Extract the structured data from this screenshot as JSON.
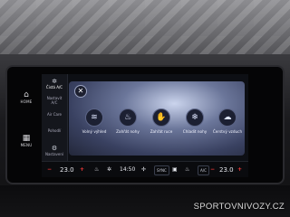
{
  "hard_keys": [
    {
      "icon": "home-icon",
      "label": "HOME"
    },
    {
      "icon": "menu-grid-icon",
      "label": "MENU"
    }
  ],
  "sidebar": [
    {
      "label": "Čistá A/C"
    },
    {
      "label": "Nastavit A/C"
    },
    {
      "label": "Air Care"
    },
    {
      "label": "Pohodlí"
    },
    {
      "label": "Nastavení"
    }
  ],
  "options": [
    {
      "icon": "defrost-icon",
      "label": "Volný výhled"
    },
    {
      "icon": "seat-heat-icon",
      "label": "Zahřát nohy"
    },
    {
      "icon": "hand-heat-icon",
      "label": "Zahřát ruce"
    },
    {
      "icon": "seat-cool-icon",
      "label": "Chladit nohy"
    },
    {
      "icon": "air-fresh-icon",
      "label": "Čerstvý vzduch"
    }
  ],
  "bottom_bar": {
    "left_temp": "23.0",
    "right_temp": "23.0",
    "minus": "−",
    "plus": "+",
    "clock": "14:50",
    "sync": "SYNC",
    "ac": "A/C"
  },
  "watermark": "SPORTOVNIVOZY.CZ"
}
